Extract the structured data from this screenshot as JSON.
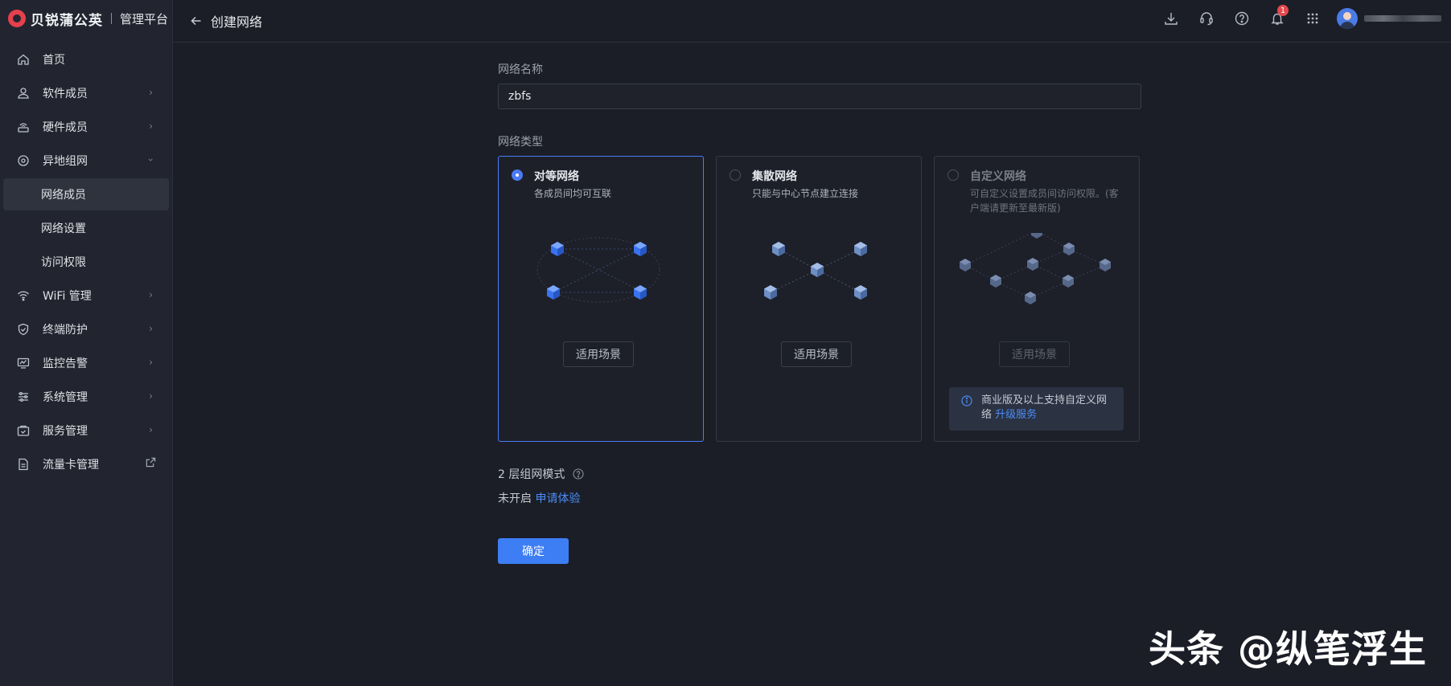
{
  "brand": {
    "name": "贝锐蒲公英",
    "subtitle": "管理平台"
  },
  "sidebar": {
    "items": [
      {
        "label": "首页",
        "icon": "home-icon"
      },
      {
        "label": "软件成员",
        "icon": "user-icon"
      },
      {
        "label": "硬件成员",
        "icon": "router-icon"
      },
      {
        "label": "异地组网",
        "icon": "network-icon"
      },
      {
        "label": "网络成员"
      },
      {
        "label": "网络设置"
      },
      {
        "label": "访问权限"
      },
      {
        "label": "WiFi 管理",
        "icon": "wifi-icon"
      },
      {
        "label": "终端防护",
        "icon": "shield-icon"
      },
      {
        "label": "监控告警",
        "icon": "monitor-icon"
      },
      {
        "label": "系统管理",
        "icon": "sliders-icon"
      },
      {
        "label": "服务管理",
        "icon": "service-icon"
      },
      {
        "label": "流量卡管理",
        "icon": "document-icon"
      }
    ]
  },
  "header": {
    "title": "创建网络",
    "notification_count": "1"
  },
  "form": {
    "name_label": "网络名称",
    "name_value": "zbfs",
    "type_label": "网络类型",
    "types": [
      {
        "title": "对等网络",
        "desc": "各成员间均可互联",
        "button": "适用场景",
        "selected": true
      },
      {
        "title": "集散网络",
        "desc": "只能与中心节点建立连接",
        "button": "适用场景",
        "selected": false
      },
      {
        "title": "自定义网络",
        "desc": "可自定义设置成员间访问权限。(客户端请更新至最新版)",
        "button": "适用场景",
        "selected": false
      }
    ],
    "custom_notice": {
      "text": "商业版及以上支持自定义网络",
      "link": "升级服务"
    },
    "layer2_label": "2 层组网模式",
    "layer2_status": "未开启",
    "layer2_link": "申请体验",
    "confirm_label": "确定"
  },
  "watermark": "头条 @纵笔浮生",
  "colors": {
    "accent": "#3d7ef5",
    "badge": "#e5484d",
    "brand": "#e6404d"
  }
}
